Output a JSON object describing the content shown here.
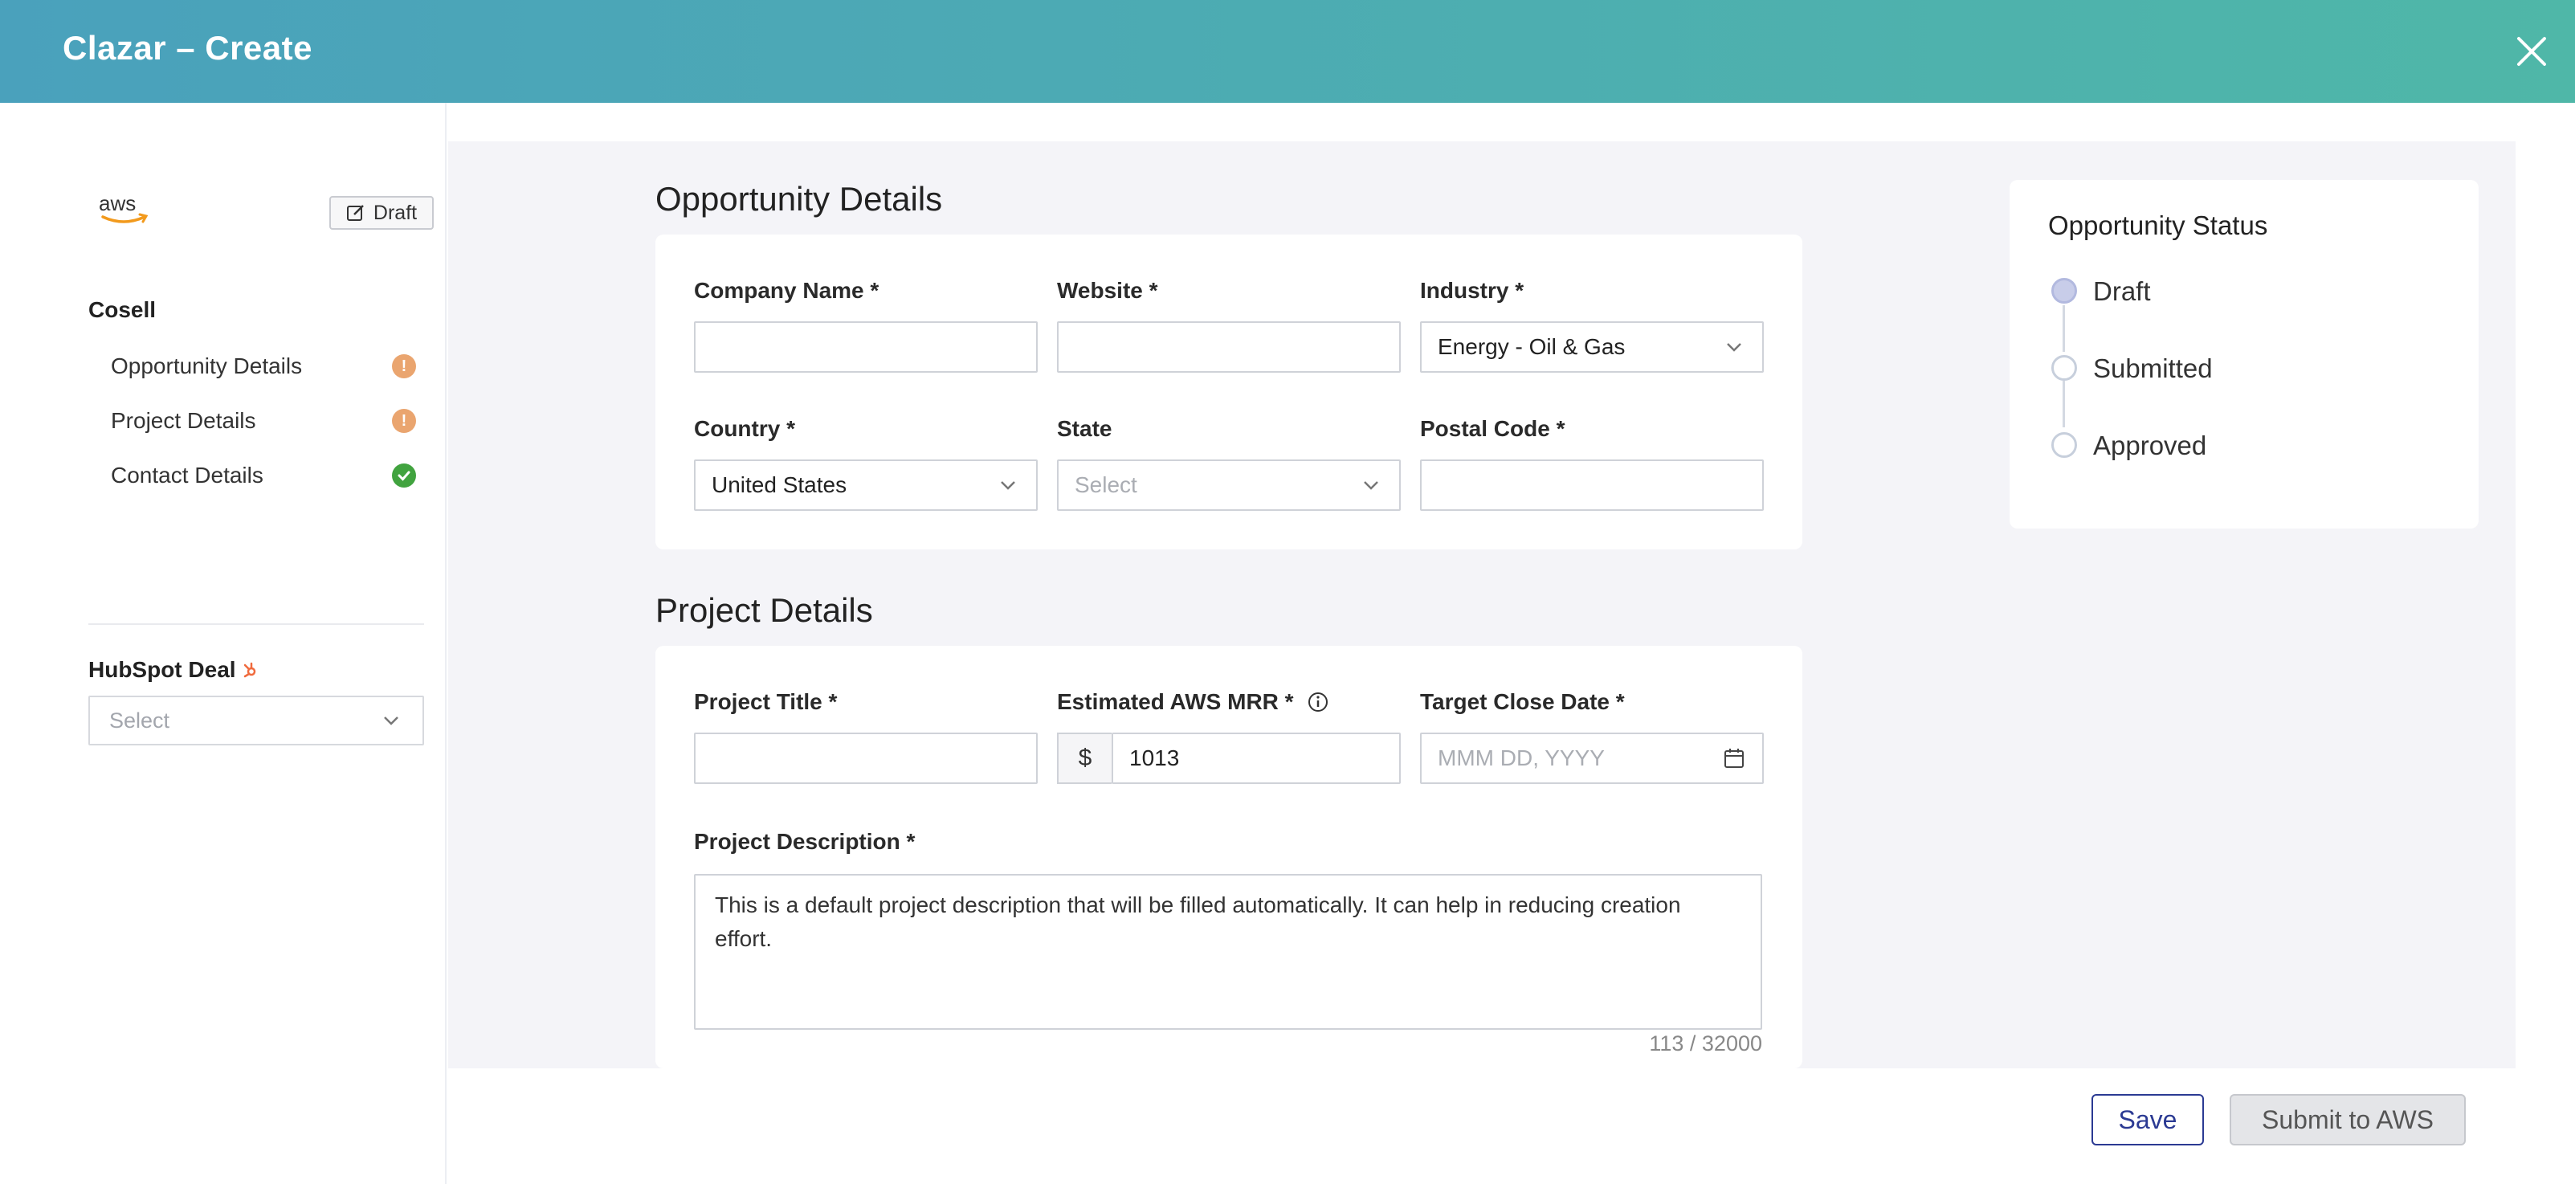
{
  "header": {
    "title": "Clazar – Create"
  },
  "sidebar": {
    "draft_badge": "Draft",
    "section_title": "Cosell",
    "nav_items": [
      {
        "label": "Opportunity Details",
        "status": "warning",
        "status_color": "#eaa56f"
      },
      {
        "label": "Project Details",
        "status": "warning",
        "status_color": "#eaa56f"
      },
      {
        "label": "Contact Details",
        "status": "complete",
        "status_color": "#41a33f"
      }
    ],
    "hubspot_label": "HubSpot Deal",
    "hubspot_placeholder": "Select"
  },
  "opportunity": {
    "title": "Opportunity Details",
    "company_label": "Company Name *",
    "company_value": "",
    "website_label": "Website *",
    "website_value": "",
    "industry_label": "Industry *",
    "industry_value": "Energy - Oil & Gas",
    "country_label": "Country *",
    "country_value": "United States",
    "state_label": "State",
    "state_placeholder": "Select",
    "postal_label": "Postal Code *",
    "postal_value": ""
  },
  "project": {
    "title": "Project Details",
    "project_title_label": "Project Title *",
    "project_title_value": "",
    "mrr_label": "Estimated AWS MRR *",
    "currency_symbol": "$",
    "mrr_value": "1013",
    "close_date_label": "Target Close Date *",
    "close_date_placeholder": "MMM DD, YYYY",
    "description_label": "Project Description *",
    "description_value": "This is a default project description that will be filled automatically. It can help in reducing creation effort.",
    "char_counter": "113 / 32000"
  },
  "status_panel": {
    "title": "Opportunity Status",
    "steps": [
      {
        "label": "Draft",
        "active": true
      },
      {
        "label": "Submitted",
        "active": false
      },
      {
        "label": "Approved",
        "active": false
      }
    ]
  },
  "footer": {
    "save_label": "Save",
    "submit_label": "Submit to AWS"
  },
  "colors": {
    "header_gradient_start": "#4aa1bc",
    "header_gradient_end": "#4fb7a8",
    "primary": "#2b3a93",
    "warning": "#eaa56f",
    "success": "#41a33f",
    "aws_orange": "#f29a1d"
  },
  "icons": [
    "close-icon",
    "aws-logo",
    "edit-icon",
    "warning-icon",
    "check-icon",
    "hubspot-icon",
    "chevron-down-icon",
    "info-icon",
    "calendar-icon"
  ]
}
